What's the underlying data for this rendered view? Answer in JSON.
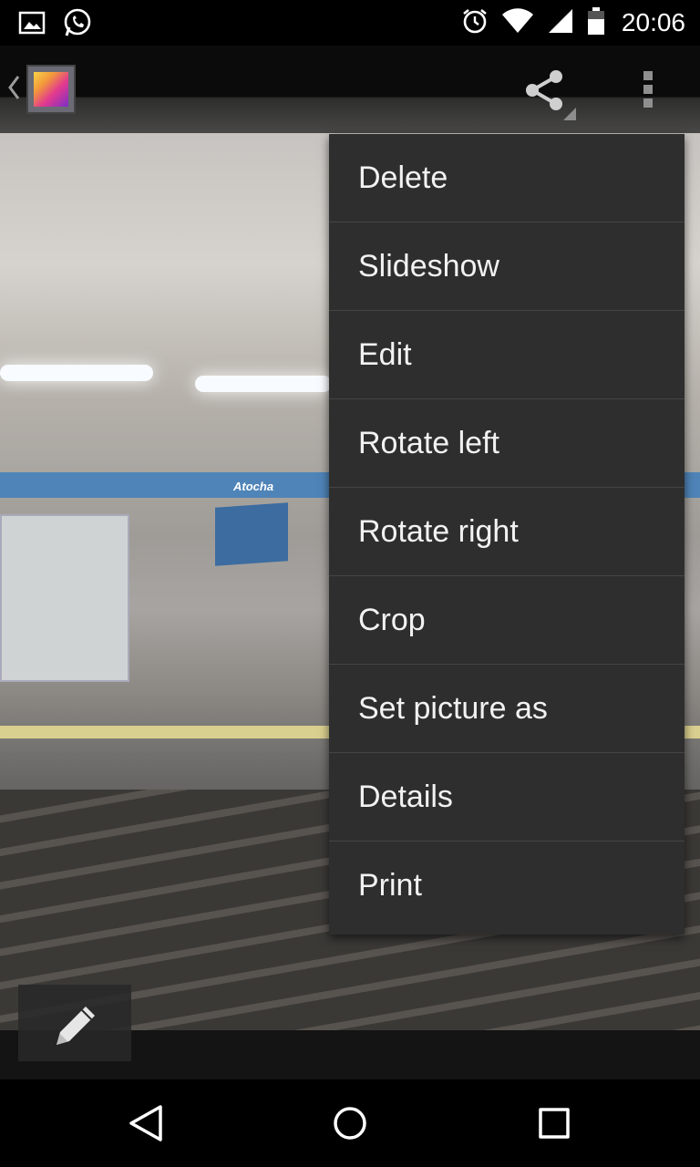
{
  "status_bar": {
    "time": "20:06",
    "icons": [
      "picture-notification-icon",
      "whatsapp-icon",
      "alarm-icon",
      "wifi-icon",
      "cell-signal-icon",
      "battery-icon"
    ]
  },
  "action_bar": {
    "icons": [
      "up-caret-icon",
      "gallery-app-icon",
      "share-icon",
      "overflow-menu-icon"
    ]
  },
  "photo": {
    "sign_text": "Atocha"
  },
  "overflow_menu": {
    "items": [
      {
        "label": "Delete"
      },
      {
        "label": "Slideshow"
      },
      {
        "label": "Edit"
      },
      {
        "label": "Rotate left"
      },
      {
        "label": "Rotate right"
      },
      {
        "label": "Crop"
      },
      {
        "label": "Set picture as"
      },
      {
        "label": "Details"
      },
      {
        "label": "Print"
      }
    ]
  },
  "edit_button": {
    "icon": "pencil-icon"
  },
  "nav_bar": {
    "icons": [
      "back-icon",
      "home-icon",
      "recents-icon"
    ]
  }
}
